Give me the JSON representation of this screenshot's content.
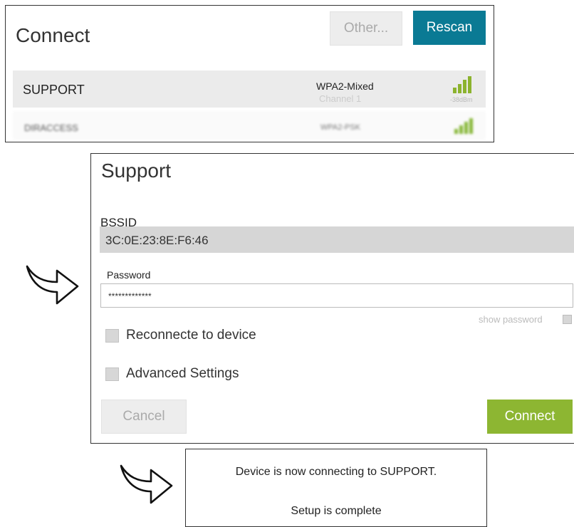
{
  "connect_panel": {
    "title": "Connect",
    "other_button": "Other...",
    "rescan_button": "Rescan",
    "networks": [
      {
        "ssid": "SUPPORT",
        "security": "WPA2-Mixed",
        "channel": "Channel 1",
        "signal": "-38dBm"
      },
      {
        "ssid": "DIRACCESS",
        "security": "WPA2-PSK"
      }
    ]
  },
  "support_panel": {
    "title": "Support",
    "bssid_label": "BSSID",
    "bssid_value": "3C:0E:23:8E:F6:46",
    "password_label": "Password",
    "password_value": "*************",
    "show_password_label": "show password",
    "reconnect_label": "Reconnecte to device",
    "advanced_label": "Advanced Settings",
    "cancel_button": "Cancel",
    "connect_button": "Connect"
  },
  "status_panel": {
    "line1": "Device is now connecting to SUPPORT.",
    "line2": "Setup is complete"
  },
  "colors": {
    "rescan_bg": "#0a7a94",
    "connect_bg": "#8db632",
    "signal": "#8cb32e"
  }
}
